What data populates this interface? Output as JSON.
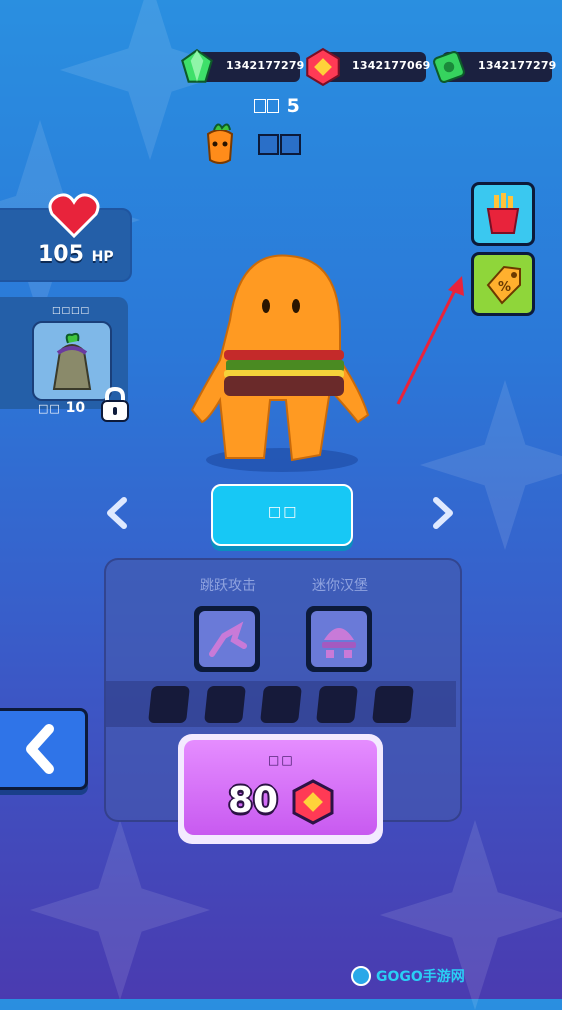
{
  "currency": {
    "gems": "1342177279",
    "coins": "1342177069",
    "cash": "1342177279"
  },
  "level": {
    "label": "□□",
    "value": "5"
  },
  "character_label": "□□",
  "hp": {
    "value": "105",
    "unit": "HP"
  },
  "skill_card": {
    "title": "□□□□",
    "level_label": "□□",
    "level_value": "10"
  },
  "choose_button": "□□",
  "skills": [
    "跳跃攻击",
    "迷你汉堡"
  ],
  "buy": {
    "label": "□□",
    "price": "80"
  },
  "watermark": "GOGO手游网"
}
